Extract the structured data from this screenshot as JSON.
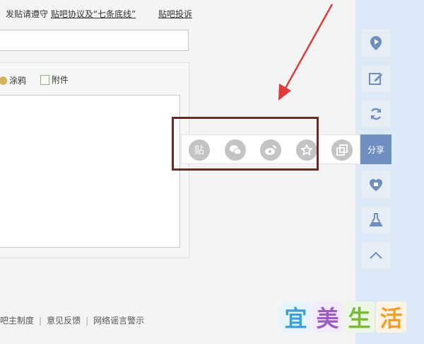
{
  "notice": {
    "text": "发贴请遵守",
    "agreement_link": "贴吧协议及“七条底线”",
    "complaint_link": "贴吧投诉"
  },
  "editor": {
    "doodle_label": "涂鸦",
    "attachment_label": "附件"
  },
  "footer": {
    "links": [
      "吧主制度",
      "意见反馈",
      "网络谣言警示"
    ]
  },
  "share_panel": {
    "items": [
      {
        "name": "tieba-share",
        "glyph": "贴"
      },
      {
        "name": "wechat-share",
        "icon": "wechat-icon"
      },
      {
        "name": "weibo-share",
        "icon": "weibo-icon"
      },
      {
        "name": "favorite-share",
        "icon": "star-icon"
      },
      {
        "name": "copy-share",
        "icon": "copy-icon"
      }
    ]
  },
  "sidebar": {
    "share_label": "分享",
    "buttons": [
      "play-icon",
      "edit-icon",
      "refresh-icon",
      "share-button",
      "heart-icon",
      "flask-icon",
      "chevron-up-icon"
    ]
  },
  "logo": {
    "chars": [
      "宜",
      "美",
      "生",
      "活"
    ],
    "colors": [
      "#3aa0d8",
      "#9a5cc0",
      "#7ab93a",
      "#f0a02a"
    ]
  },
  "colors": {
    "sidebar_bg": "#dce9f6",
    "share_accent": "#6f8fc0",
    "highlight_border": "#6b2a22",
    "arrow": "#e03a3a"
  }
}
